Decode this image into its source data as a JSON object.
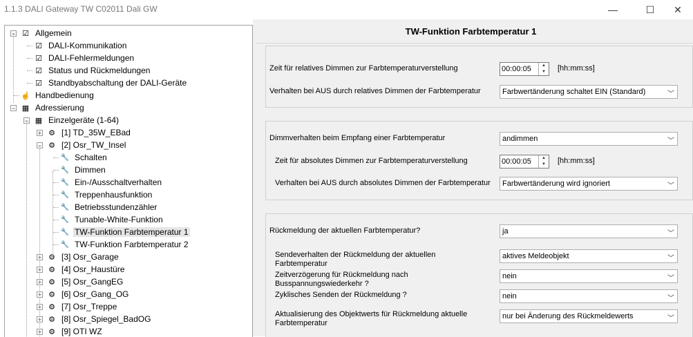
{
  "window": {
    "title": "1.1.3 DALI Gateway TW C02011 Dali GW",
    "minimize_glyph": "—",
    "maximize_glyph": "☐",
    "close_glyph": "✕"
  },
  "tree": {
    "items": [
      {
        "label": "Allgemein",
        "icon": "param-group-icon"
      },
      {
        "label": "DALI-Kommunikation",
        "icon": "param-page-icon"
      },
      {
        "label": "DALI-Fehlermeldungen",
        "icon": "param-page-icon"
      },
      {
        "label": "Status und Rückmeldungen",
        "icon": "param-page-icon"
      },
      {
        "label": "Standbyabschaltung der DALI-Geräte",
        "icon": "param-page-icon"
      },
      {
        "label": "Handbedienung",
        "icon": "hand-icon"
      },
      {
        "label": "Adressierung",
        "icon": "grid-icon"
      },
      {
        "label": "Einzelgeräte (1-64)",
        "icon": "grid-icon"
      },
      {
        "label": "[1] TD_35W_EBad",
        "icon": "device-icon"
      },
      {
        "label": "[2] Osr_TW_Insel",
        "icon": "device-icon"
      },
      {
        "label": "Schalten",
        "icon": "tool-icon"
      },
      {
        "label": "Dimmen",
        "icon": "tool-icon"
      },
      {
        "label": "Ein-/Ausschaltverhalten",
        "icon": "tool-icon"
      },
      {
        "label": "Treppenhausfunktion",
        "icon": "tool-icon"
      },
      {
        "label": "Betriebsstundenzähler",
        "icon": "tool-icon"
      },
      {
        "label": "Tunable-White-Funktion",
        "icon": "tool-icon"
      },
      {
        "label": "TW-Funktion Farbtemperatur 1",
        "icon": "tool-icon"
      },
      {
        "label": "TW-Funktion Farbtemperatur 2",
        "icon": "tool-icon"
      },
      {
        "label": "[3] Osr_Garage",
        "icon": "device-icon"
      },
      {
        "label": "[4] Osr_Haustüre",
        "icon": "device-icon"
      },
      {
        "label": "[5] Osr_GangEG",
        "icon": "device-icon"
      },
      {
        "label": "[6] Osr_Gang_OG",
        "icon": "device-icon"
      },
      {
        "label": "[7] Osr_Treppe",
        "icon": "device-icon"
      },
      {
        "label": "[8] Osr_Spiegel_BadOG",
        "icon": "device-icon"
      },
      {
        "label": "[9] OTI WZ",
        "icon": "device-icon"
      }
    ],
    "selected_index": 16
  },
  "panel": {
    "title": "TW-Funktion Farbtemperatur 1",
    "group1": {
      "rel_time_label": "Zeit für relatives Dimmen zur Farbtemperaturverstellung",
      "rel_time_value": "00:00:05",
      "rel_time_unit": "[hh:mm:ss]",
      "off_rel_label": "Verhalten bei AUS durch relatives Dimmen der Farbtemperatur",
      "off_rel_value": "Farbwertänderung schaltet EIN (Standard)"
    },
    "group2": {
      "recv_label": "Dimmverhalten beim Empfang einer Farbtemperatur",
      "recv_value": "andimmen",
      "abs_time_label": "Zeit für absolutes Dimmen zur Farbtemperaturverstellung",
      "abs_time_value": "00:00:05",
      "abs_time_unit": "[hh:mm:ss]",
      "off_abs_label": "Verhalten bei AUS durch absolutes Dimmen der Farbtemperatur",
      "off_abs_value": "Farbwertänderung wird ignoriert"
    },
    "group3": {
      "feedback_label": "Rückmeldung der aktuellen Farbtemperatur?",
      "feedback_value": "ja",
      "send_label": "Sendeverhalten der Rückmeldung der aktuellen Farbtemperatur",
      "send_value": "aktives Meldeobjekt",
      "delay_label": "Zeitverzögerung für Rückmeldung nach Busspannungswiederkehr ?",
      "delay_value": "nein",
      "cyclic_label": "Zyklisches Senden der Rückmeldung ?",
      "cyclic_value": "nein",
      "update_label": "Aktualisierung des Objektwerts für Rückmeldung aktuelle Farbtemperatur",
      "update_value": "nur bei Änderung des Rückmeldewerts"
    }
  }
}
